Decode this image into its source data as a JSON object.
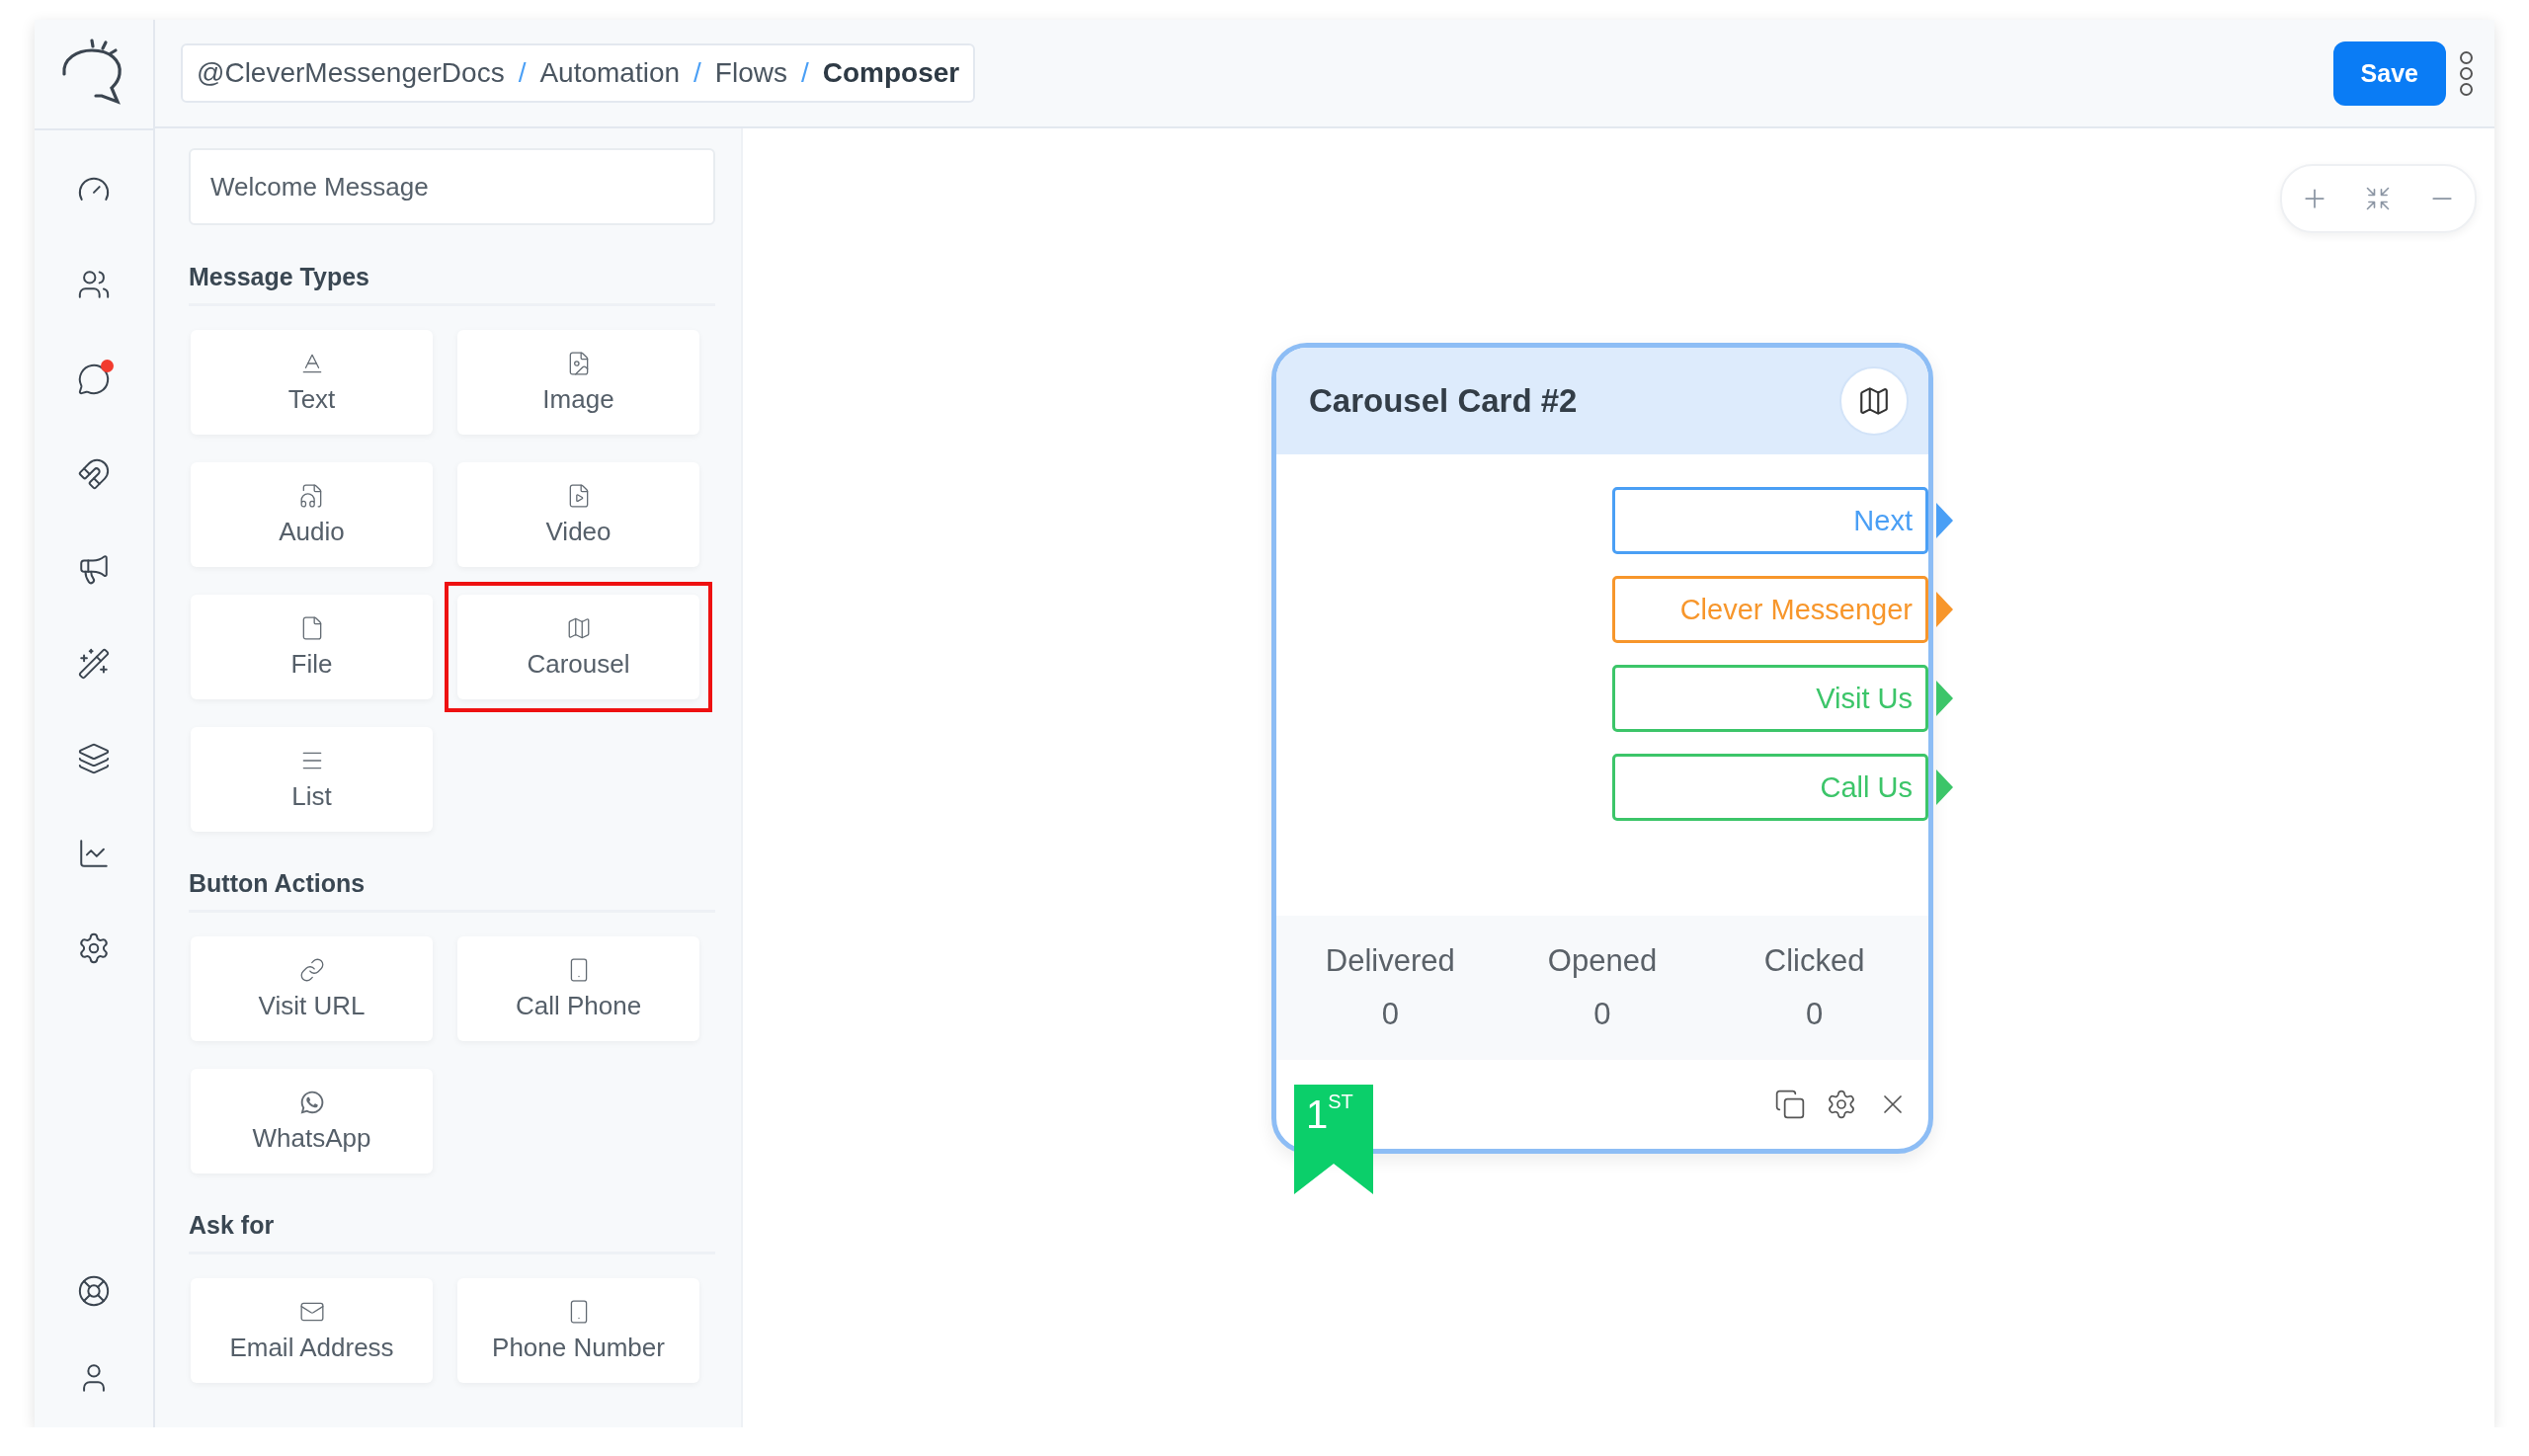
{
  "sidebar": {
    "items": [
      {
        "kind": "dashboard",
        "badge": false
      },
      {
        "kind": "contacts",
        "badge": false
      },
      {
        "kind": "chat",
        "badge": true
      },
      {
        "kind": "magnet",
        "badge": false
      },
      {
        "kind": "broadcast",
        "badge": false
      },
      {
        "kind": "magic",
        "badge": false
      },
      {
        "kind": "layers",
        "badge": false
      },
      {
        "kind": "analytics",
        "badge": false
      },
      {
        "kind": "settings",
        "badge": false
      }
    ],
    "bottom_items": [
      {
        "kind": "help",
        "badge": false
      },
      {
        "kind": "account",
        "badge": false
      }
    ]
  },
  "breadcrumb": [
    {
      "label": "@CleverMessengerDocs",
      "current": false
    },
    {
      "separator": "/",
      "label": "Automation",
      "current": false
    },
    {
      "separator": "/",
      "label": "Flows",
      "current": false
    },
    {
      "separator": "/",
      "label": "Composer",
      "current": true
    }
  ],
  "save_button": "Save",
  "panel": {
    "name_field": {
      "value": "Welcome Message"
    },
    "sections": [
      {
        "title": "Message Types",
        "items": [
          {
            "label": "Text",
            "kind": "text",
            "highlighted": false
          },
          {
            "label": "Image",
            "kind": "image",
            "highlighted": false
          },
          {
            "label": "Audio",
            "kind": "audio",
            "highlighted": false
          },
          {
            "label": "Video",
            "kind": "video",
            "highlighted": false
          },
          {
            "label": "File",
            "kind": "file",
            "highlighted": false
          },
          {
            "label": "Carousel",
            "kind": "carousel",
            "highlighted": true
          },
          {
            "label": "List",
            "kind": "list",
            "highlighted": false
          }
        ]
      },
      {
        "title": "Button Actions",
        "items": [
          {
            "label": "Visit URL",
            "kind": "link",
            "highlighted": false
          },
          {
            "label": "Call Phone",
            "kind": "phone",
            "highlighted": false
          },
          {
            "label": "WhatsApp",
            "kind": "whatsapp",
            "highlighted": false
          }
        ]
      },
      {
        "title": "Ask for",
        "items": [
          {
            "label": "Email Address",
            "kind": "email",
            "highlighted": false
          },
          {
            "label": "Phone Number",
            "kind": "phone",
            "highlighted": false
          }
        ]
      }
    ]
  },
  "card": {
    "title": "Carousel Card #2",
    "buttons": [
      {
        "label": "Next",
        "color": "#4a9ff5"
      },
      {
        "label": "Clever Messenger",
        "color": "#f7962b"
      },
      {
        "label": "Visit Us",
        "color": "#3cc569"
      },
      {
        "label": "Call Us",
        "color": "#3cc569"
      }
    ],
    "stats": [
      {
        "label": "Delivered",
        "value": "0"
      },
      {
        "label": "Opened",
        "value": "0"
      },
      {
        "label": "Clicked",
        "value": "0"
      }
    ],
    "rank": "1$^{ST}$"
  }
}
